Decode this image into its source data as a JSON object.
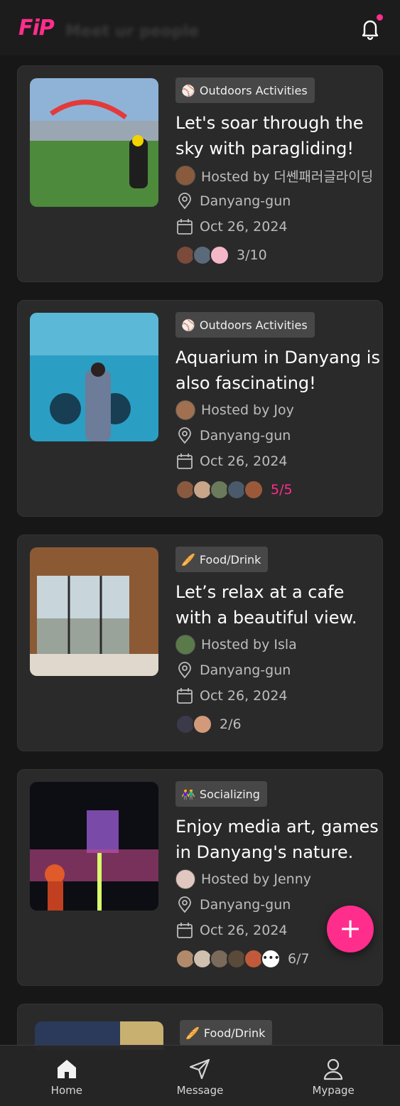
{
  "header": {
    "logo": "FiP",
    "title": "Meet ur people",
    "bell_icon": "bell-icon",
    "accent": "#ff2d8c"
  },
  "cards": [
    {
      "category": "Outdoors Activities",
      "category_icon": "baseball-icon",
      "title": "Let's soar through the sky with paragliding!",
      "host": "Hosted by 더쎈패러글라이딩",
      "location": "Danyang-gun",
      "date": "Oct 26, 2024",
      "members": "3/10",
      "full": false
    },
    {
      "category": "Outdoors Activities",
      "category_icon": "baseball-icon",
      "title": "Aquarium in Danyang is also fascinating!",
      "host": "Hosted by Joy",
      "location": "Danyang-gun",
      "date": "Oct 26, 2024",
      "members": "5/5",
      "full": true
    },
    {
      "category": "Food/Drink",
      "category_icon": "bread-icon",
      "title": "Let’s relax at a cafe with a beautiful view.",
      "host": "Hosted by Isla",
      "location": "Danyang-gun",
      "date": "Oct 26, 2024",
      "members": "2/6",
      "full": false
    },
    {
      "category": "Socializing",
      "category_icon": "people-icon",
      "title": "Enjoy media art, games in Danyang's nature.",
      "host": "Hosted by Jenny",
      "location": "Danyang-gun",
      "date": "Oct 26, 2024",
      "members": "6/7",
      "full": false
    },
    {
      "category": "Food/Drink",
      "category_icon": "bread-icon"
    }
  ],
  "fab": {
    "label": "+",
    "icon": "plus-icon"
  },
  "nav": {
    "home": "Home",
    "message": "Message",
    "mypage": "Mypage"
  }
}
